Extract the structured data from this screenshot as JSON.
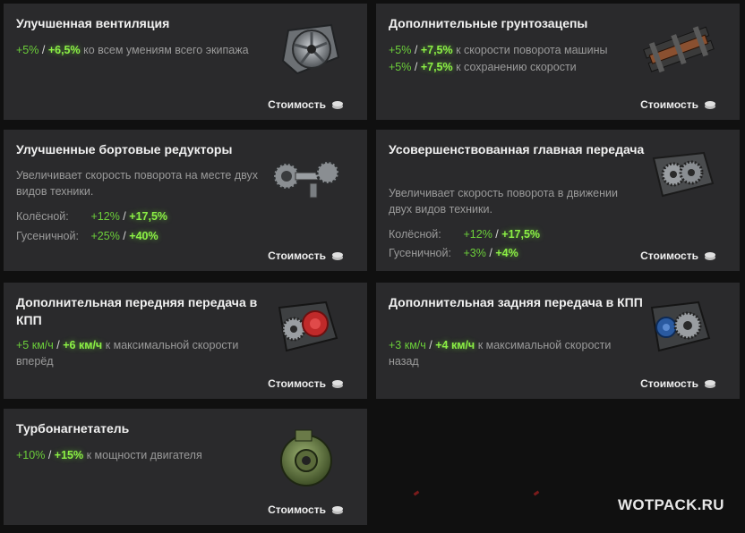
{
  "cards": [
    {
      "title": "Улучшенная вентиляция",
      "lines": [
        {
          "a": "+5%",
          "s": "/",
          "b": "+6,5%",
          "t": "ко всем умениям всего экипажа"
        }
      ],
      "icon": "ventilation-icon",
      "cost": "Стоимость"
    },
    {
      "title": "Дополнительные грунтозацепы",
      "lines": [
        {
          "a": "+5%",
          "s": "/",
          "b": "+7,5%",
          "t": "к скорости поворота машины"
        },
        {
          "a": "+5%",
          "s": "/",
          "b": "+7,5%",
          "t": "к сохранению скорости"
        }
      ],
      "icon": "grousers-icon",
      "cost": "Стоимость"
    },
    {
      "title": "Улучшенные бортовые редукторы",
      "desc": "Увеличивает скорость поворота на месте двух видов техники.",
      "rows": [
        {
          "label": "Колёсной:",
          "a": "+12%",
          "s": "/",
          "b": "+17,5%"
        },
        {
          "label": "Гусеничной:",
          "a": "+25%",
          "s": "/",
          "b": "+40%"
        }
      ],
      "icon": "gearbox-shafts-icon",
      "cost": "Стоимость"
    },
    {
      "title": "Усовершенствованная главная передача",
      "desc": "Увеличивает скорость поворота в движении двух видов техники.",
      "rows": [
        {
          "label": "Колёсной:",
          "a": "+12%",
          "s": "/",
          "b": "+17,5%"
        },
        {
          "label": "Гусеничной:",
          "a": "+3%",
          "s": "/",
          "b": "+4%"
        }
      ],
      "icon": "final-drive-icon",
      "cost": "Стоимость"
    },
    {
      "title": "Дополнительная передняя передача в КПП",
      "lines": [
        {
          "a": "+5 км/ч",
          "s": "/",
          "b": "+6 км/ч",
          "t": "к максимальной скорости"
        }
      ],
      "tail": "вперёд",
      "icon": "front-gear-icon",
      "cost": "Стоимость"
    },
    {
      "title": "Дополнительная задняя передача в КПП",
      "lines": [
        {
          "a": "+3 км/ч",
          "s": "/",
          "b": "+4 км/ч",
          "t": "к максимальной скорости"
        }
      ],
      "tail": "назад",
      "icon": "rear-gear-icon",
      "cost": "Стоимость"
    },
    {
      "title": "Турбонагнетатель",
      "lines": [
        {
          "a": "+10%",
          "s": "/",
          "b": "+15%",
          "t": "к мощности двигателя"
        }
      ],
      "icon": "turbocharger-icon",
      "cost": "Стоимость"
    }
  ],
  "watermark": "WOTPACK.RU",
  "colors": {
    "bg": "#101010",
    "card": "#2a2a2c",
    "green": "#6ccf3a",
    "green_bright": "#8cf045",
    "muted": "#9a9a9a"
  }
}
